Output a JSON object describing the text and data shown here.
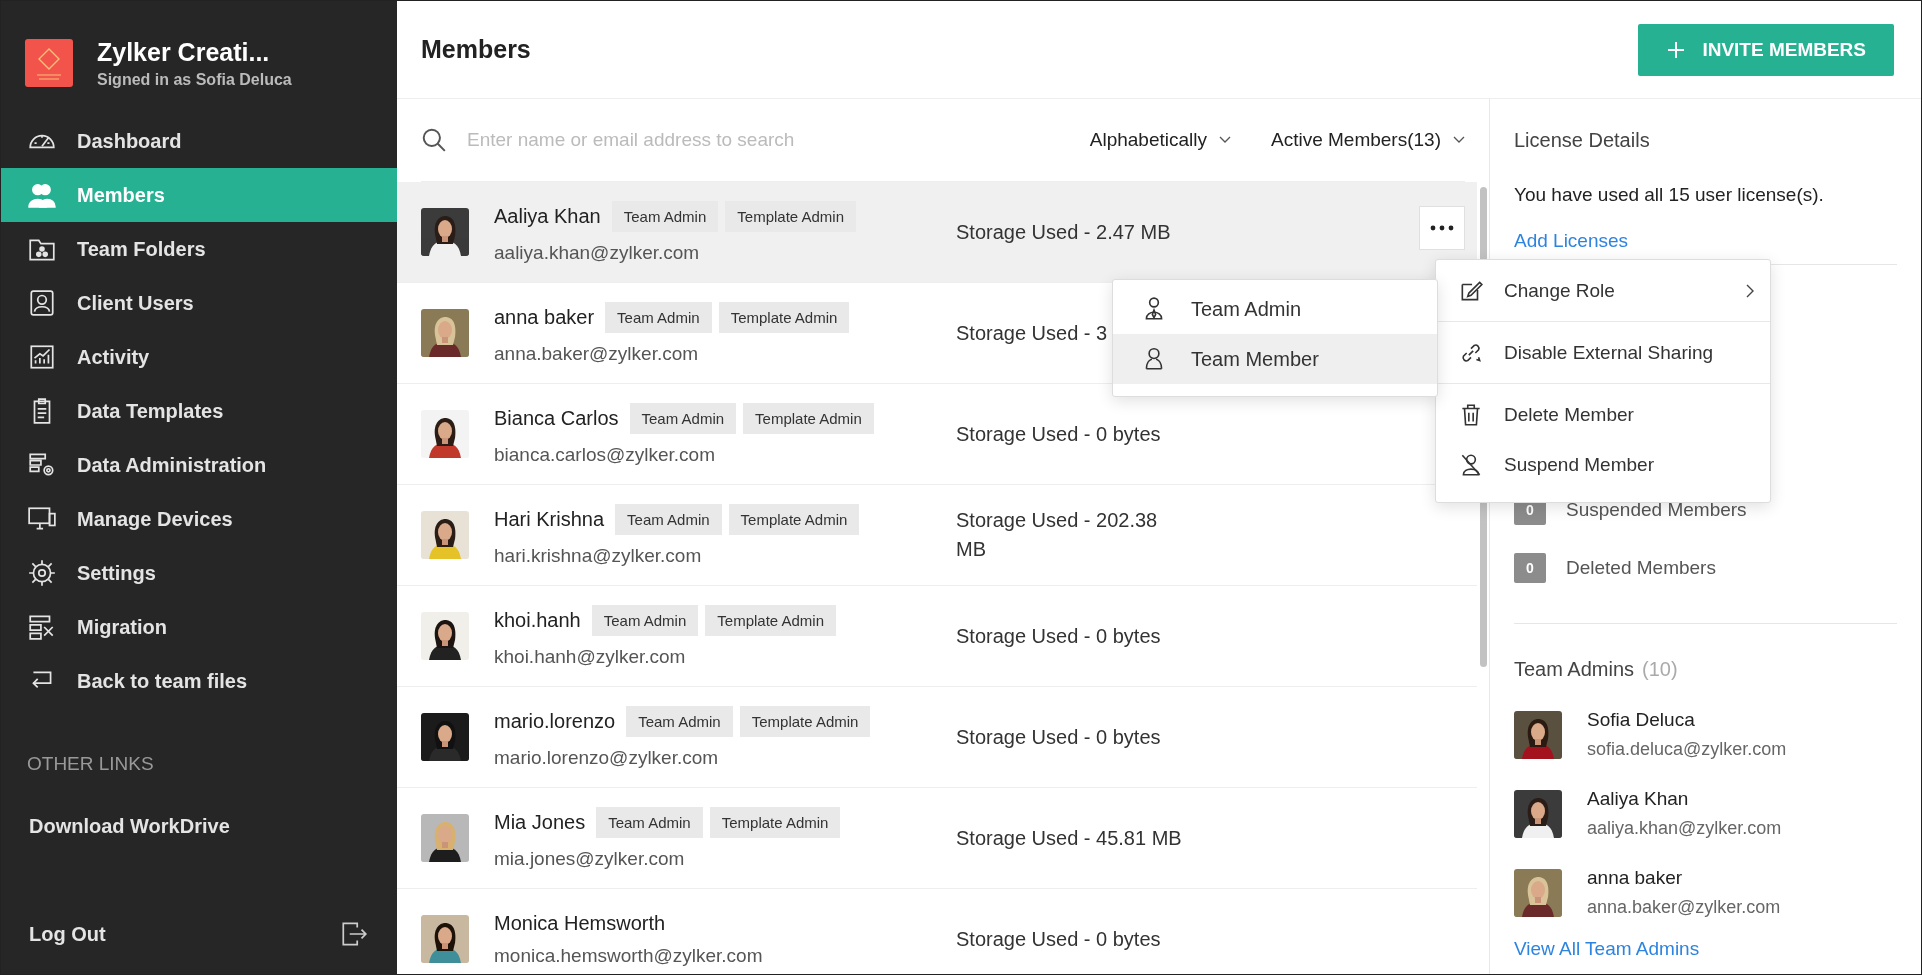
{
  "org": {
    "name": "Zylker Creati...",
    "signed_in": "Signed in as Sofia Deluca"
  },
  "nav": [
    {
      "label": "Dashboard",
      "kind": "gauge",
      "selected": false
    },
    {
      "label": "Members",
      "kind": "people",
      "selected": true
    },
    {
      "label": "Team Folders",
      "kind": "folder",
      "selected": false
    },
    {
      "label": "Client Users",
      "kind": "user",
      "selected": false
    },
    {
      "label": "Activity",
      "kind": "chart",
      "selected": false
    },
    {
      "label": "Data Templates",
      "kind": "clipboard",
      "selected": false
    },
    {
      "label": "Data Administration",
      "kind": "gearlist",
      "selected": false
    },
    {
      "label": "Manage Devices",
      "kind": "devices",
      "selected": false
    },
    {
      "label": "Settings",
      "kind": "gear",
      "selected": false
    },
    {
      "label": "Migration",
      "kind": "migrate",
      "selected": false
    },
    {
      "label": "Back to team files",
      "kind": "back",
      "selected": false
    }
  ],
  "other_links": {
    "heading": "OTHER LINKS",
    "items": [
      "Download WorkDrive"
    ]
  },
  "logout": "Log Out",
  "page_title": "Members",
  "invite_button": "INVITE MEMBERS",
  "search": {
    "placeholder": "Enter name or email address to search"
  },
  "sort": "Alphabetically",
  "filter": "Active Members(13)",
  "members": [
    {
      "name": "Aaliya Khan",
      "tags": [
        "Team Admin",
        "Template Admin"
      ],
      "email": "aaliya.khan@zylker.com",
      "storage": "Storage Used - 2.47 MB",
      "selected": true
    },
    {
      "name": "anna baker",
      "tags": [
        "Team Admin",
        "Template Admin"
      ],
      "email": "anna.baker@zylker.com",
      "storage": "Storage Used - 3",
      "selected": false
    },
    {
      "name": "Bianca Carlos",
      "tags": [
        "Team Admin",
        "Template Admin"
      ],
      "email": "bianca.carlos@zylker.com",
      "storage": "Storage Used - 0 bytes",
      "selected": false
    },
    {
      "name": "Hari Krishna",
      "tags": [
        "Team Admin",
        "Template Admin"
      ],
      "email": "hari.krishna@zylker.com",
      "storage": "Storage Used - 202.38 MB",
      "selected": false
    },
    {
      "name": "khoi.hanh",
      "tags": [
        "Team Admin",
        "Template Admin"
      ],
      "email": "khoi.hanh@zylker.com",
      "storage": "Storage Used - 0 bytes",
      "selected": false
    },
    {
      "name": "mario.lorenzo",
      "tags": [
        "Team Admin",
        "Template Admin"
      ],
      "email": "mario.lorenzo@zylker.com",
      "storage": "Storage Used - 0 bytes",
      "selected": false
    },
    {
      "name": "Mia Jones",
      "tags": [
        "Team Admin",
        "Template Admin"
      ],
      "email": "mia.jones@zylker.com",
      "storage": "Storage Used - 45.81 MB",
      "selected": false
    },
    {
      "name": "Monica Hemsworth",
      "email": "monica.hemsworth@zylker.com",
      "storage": "Storage Used - 0 bytes",
      "selected": false
    }
  ],
  "license": {
    "title": "License Details",
    "text": "You have used all 15 user license(s).",
    "link": "Add Licenses",
    "stats": [
      {
        "count": "0",
        "label": "Suspended Members"
      },
      {
        "count": "0",
        "label": "Deleted Members"
      }
    ]
  },
  "team_admins": {
    "title": "Team Admins",
    "count": "(10)",
    "admins": [
      {
        "name": "Sofia Deluca",
        "email": "sofia.deluca@zylker.com"
      },
      {
        "name": "Aaliya Khan",
        "email": "aaliya.khan@zylker.com"
      },
      {
        "name": "anna baker",
        "email": "anna.baker@zylker.com"
      }
    ],
    "link": "View All Team Admins"
  },
  "context_menu": [
    {
      "label": "Change Role",
      "kind": "edit",
      "submenu": true
    },
    {
      "label": "Disable External Sharing",
      "kind": "link",
      "submenu": false
    },
    {
      "label": "Delete Member",
      "kind": "trash",
      "submenu": false
    },
    {
      "label": "Suspend Member",
      "kind": "suspend",
      "submenu": false
    }
  ],
  "role_submenu": [
    {
      "label": "Team Admin",
      "kind": "admin",
      "selected": false
    },
    {
      "label": "Team Member",
      "kind": "member",
      "selected": true
    }
  ]
}
